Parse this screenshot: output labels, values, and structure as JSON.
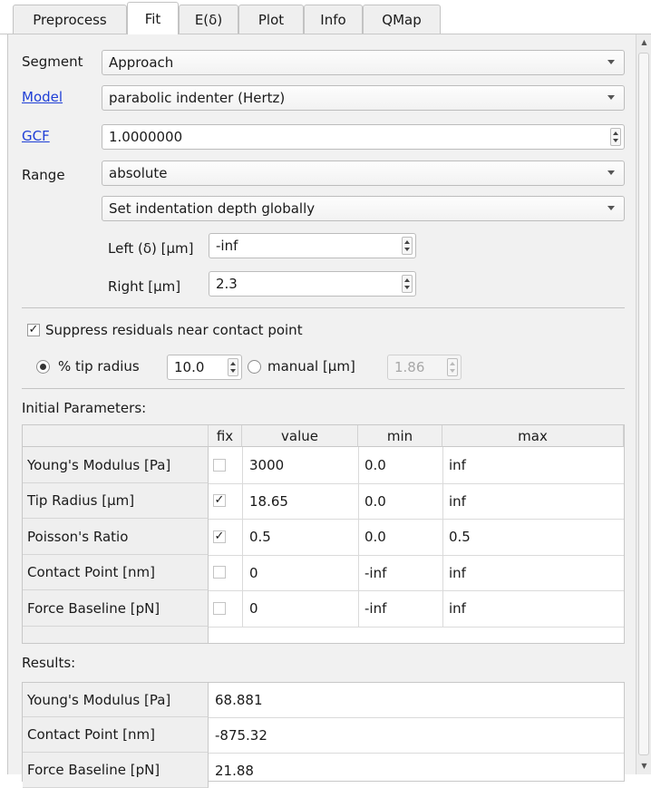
{
  "tabs": [
    "Preprocess",
    "Fit",
    "E(δ)",
    "Plot",
    "Info",
    "QMap"
  ],
  "active_tab": "Fit",
  "form": {
    "segment_label": "Segment",
    "segment_value": "Approach",
    "model_label": "Model",
    "model_value": "parabolic indenter (Hertz)",
    "gcf_label": "GCF",
    "gcf_value": "1.0000000",
    "range_label": "Range",
    "range_value": "absolute",
    "depth_mode_value": "Set indentation depth globally",
    "left_label": "Left (δ) [µm]",
    "left_value": "-inf",
    "right_label": "Right [µm]",
    "right_value": "2.3"
  },
  "residuals": {
    "suppress_label": "Suppress residuals near contact point",
    "suppress_checked": true,
    "tip_radius_label": "% tip radius",
    "tip_radius_value": "10.0",
    "manual_label": "manual [µm]",
    "manual_value": "1.86",
    "selected": "tip_radius"
  },
  "initial_parameters": {
    "title": "Initial Parameters:",
    "columns": [
      "fix",
      "value",
      "min",
      "max"
    ],
    "rows": [
      {
        "name": "Young's Modulus [Pa]",
        "fix": false,
        "value": "3000",
        "min": "0.0",
        "max": "inf"
      },
      {
        "name": "Tip Radius [µm]",
        "fix": true,
        "value": "18.65",
        "min": "0.0",
        "max": "inf"
      },
      {
        "name": "Poisson's Ratio",
        "fix": true,
        "value": "0.5",
        "min": "0.0",
        "max": "0.5"
      },
      {
        "name": "Contact Point [nm]",
        "fix": false,
        "value": "0",
        "min": "-inf",
        "max": "inf"
      },
      {
        "name": "Force Baseline [pN]",
        "fix": false,
        "value": "0",
        "min": "-inf",
        "max": "inf"
      }
    ]
  },
  "results": {
    "title": "Results:",
    "rows": [
      {
        "name": "Young's Modulus [Pa]",
        "value": "68.881"
      },
      {
        "name": "Contact Point [nm]",
        "value": "-875.32"
      },
      {
        "name": "Force Baseline [pN]",
        "value": "21.88"
      }
    ]
  },
  "check_mark": "✓",
  "colors": {
    "link": "#1f3fd6",
    "panel": "#f1f1f1",
    "border": "#c8c8c8"
  }
}
